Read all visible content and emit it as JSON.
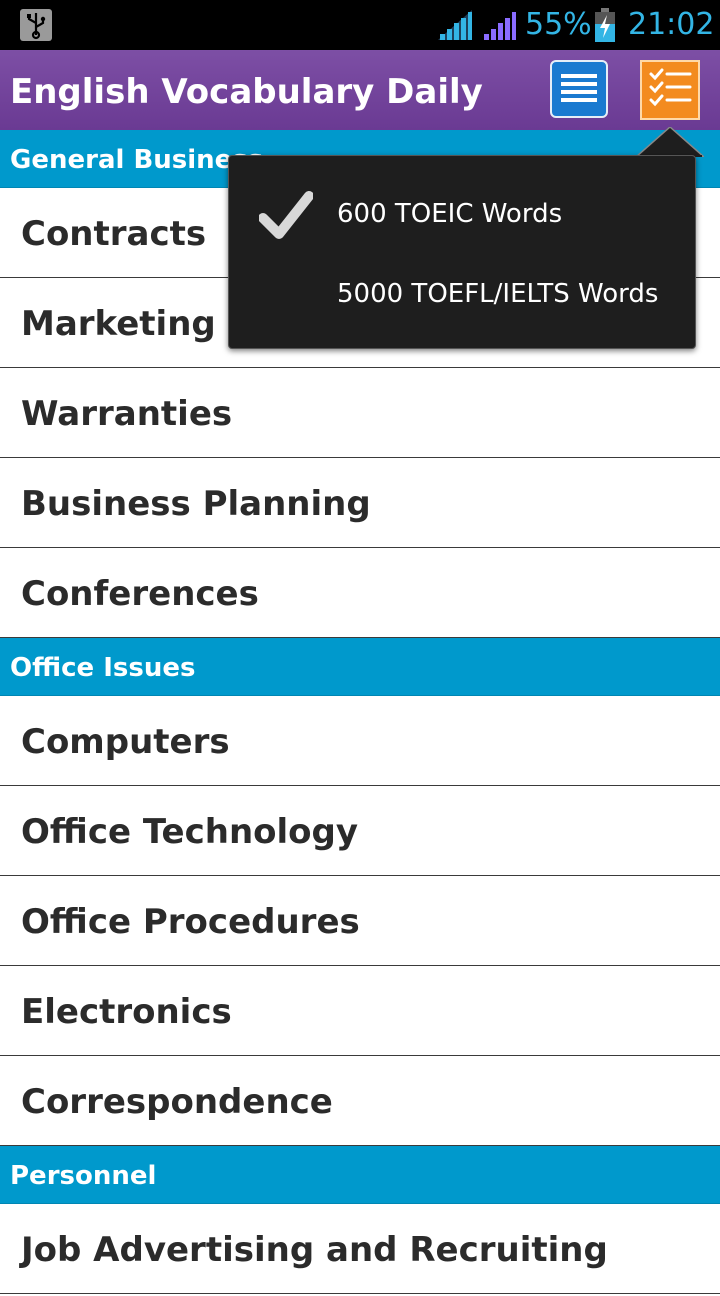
{
  "status_bar": {
    "battery_percent": "55%",
    "time": "21:02",
    "icons": [
      "usb-icon",
      "signal-icon",
      "signal-icon",
      "battery-charging-icon"
    ]
  },
  "action_bar": {
    "title": "English Vocabulary Daily",
    "buttons": [
      "menu-icon",
      "checklist-icon"
    ]
  },
  "sections": [
    {
      "header": "General Business",
      "items": [
        "Contracts",
        "Marketing",
        "Warranties",
        "Business Planning",
        "Conferences"
      ]
    },
    {
      "header": "Office Issues",
      "items": [
        "Computers",
        "Office Technology",
        "Office Procedures",
        "Electronics",
        "Correspondence"
      ]
    },
    {
      "header": "Personnel",
      "items": [
        "Job Advertising and Recruiting"
      ]
    }
  ],
  "popup_menu": {
    "items": [
      {
        "label": "600 TOEIC Words",
        "checked": true
      },
      {
        "label": "5000 TOEFL/IELTS Words",
        "checked": false
      }
    ]
  },
  "colors": {
    "status_accent": "#33b5e5",
    "action_bar": "#7449a0",
    "section_header": "#0099cc",
    "menu_button": "#1a7ad0",
    "list_button": "#f38b1f"
  }
}
